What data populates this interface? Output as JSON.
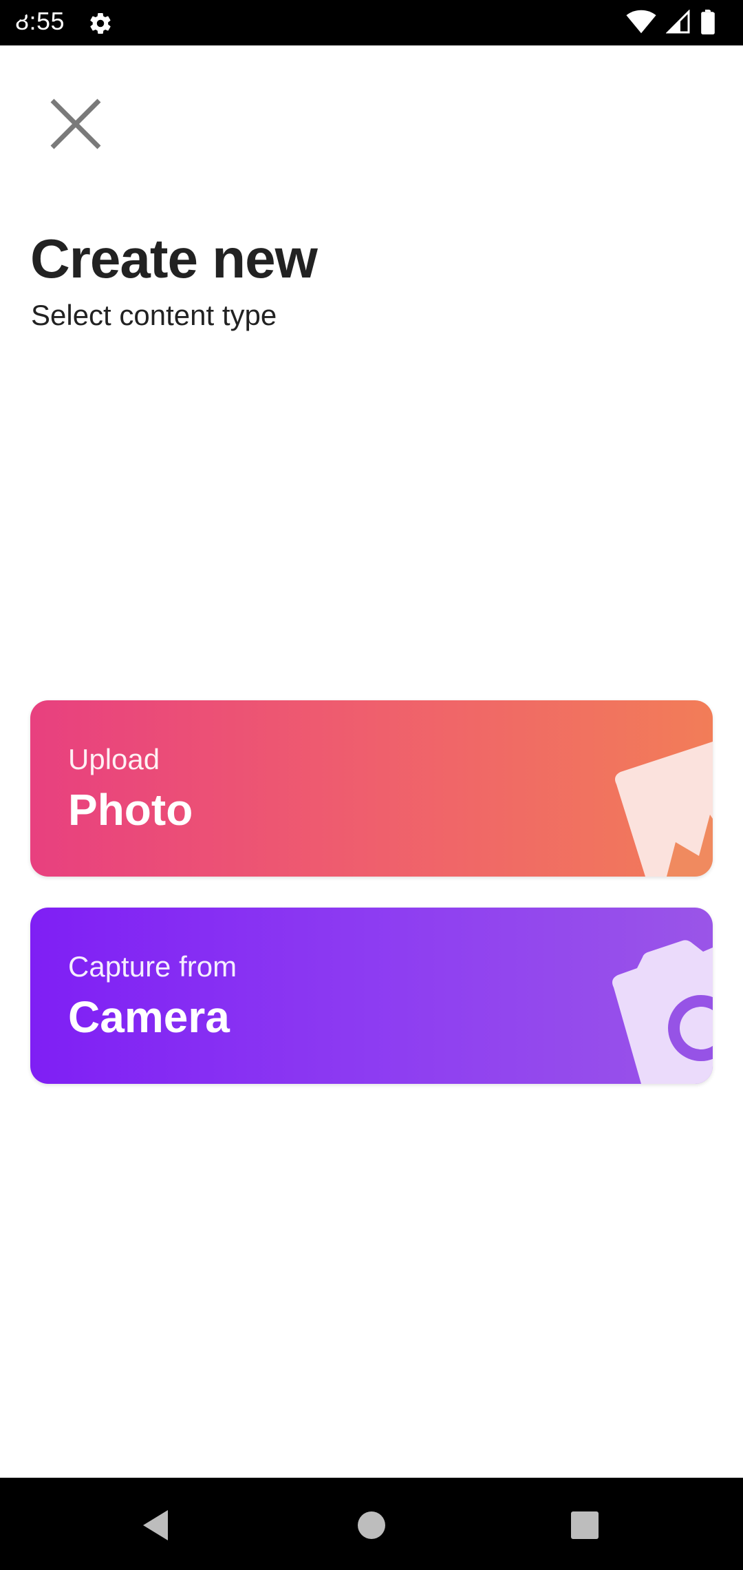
{
  "status_bar": {
    "time": "8:55",
    "icons": [
      "gear-icon",
      "wifi-icon",
      "cell-signal-icon",
      "battery-icon"
    ]
  },
  "header": {
    "close_icon": "close-icon",
    "title": "Create new",
    "subtitle": "Select content type"
  },
  "options": [
    {
      "small_label": "Upload",
      "big_label": "Photo",
      "icon": "photo-icon",
      "gradient": [
        "#e8407f",
        "#f27d58"
      ]
    },
    {
      "small_label": "Capture from",
      "big_label": "Camera",
      "icon": "camera-icon",
      "gradient": [
        "#7f1ff4",
        "#9a55e8"
      ]
    }
  ],
  "nav_bar": {
    "icons": [
      "back-icon",
      "home-icon",
      "recents-icon"
    ]
  },
  "colors": {
    "title_text": "#222222",
    "close_icon": "#7a7a7a",
    "background": "#ffffff"
  }
}
